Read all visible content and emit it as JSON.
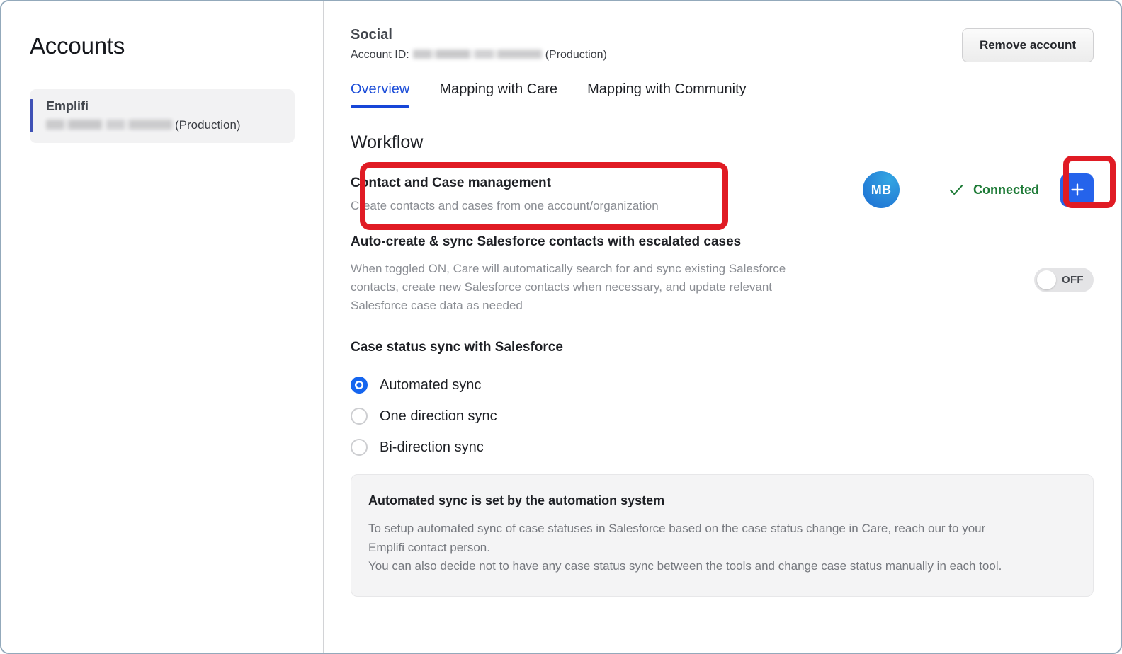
{
  "sidebar": {
    "title": "Accounts",
    "accounts": [
      {
        "name": "Emplifi",
        "id_masked": "",
        "environment": "(Production)"
      }
    ]
  },
  "header": {
    "title": "Social",
    "account_id_label": "Account ID:",
    "account_id_masked": "",
    "environment": "(Production)",
    "remove_account_label": "Remove account"
  },
  "tabs": [
    {
      "label": "Overview",
      "active": true
    },
    {
      "label": "Mapping with Care",
      "active": false
    },
    {
      "label": "Mapping with Community",
      "active": false
    }
  ],
  "workflow": {
    "section_title": "Workflow",
    "row": {
      "name": "Contact and Case management",
      "description": "Create contacts and cases from one account/organization",
      "avatar_initials": "MB",
      "status_label": "Connected",
      "status_color": "#1d7a36",
      "status_icon": "check-icon",
      "add_button_icon": "plus-icon",
      "add_button_color": "#2563eb"
    }
  },
  "auto_create": {
    "title": "Auto-create & sync Salesforce contacts with escalated cases",
    "description": "When toggled ON, Care will automatically search for and sync existing Salesforce contacts, create new Salesforce contacts when necessary, and update relevant Salesforce case data as needed",
    "toggle_state": "OFF"
  },
  "case_status_sync": {
    "title": "Case status sync with Salesforce",
    "options": [
      {
        "label": "Automated sync",
        "selected": true
      },
      {
        "label": "One direction sync",
        "selected": false
      },
      {
        "label": "Bi-direction sync",
        "selected": false
      }
    ]
  },
  "info_box": {
    "title": "Automated sync is set by the automation system",
    "line1": "To setup automated sync of case statuses in Salesforce based on the case status change in Care, reach our to your",
    "line2": "Emplifi contact person.",
    "line3": "You can also decide not to have any case status sync between the tools and change case status manually in each tool."
  },
  "annotations": {
    "color": "#e01b24",
    "targets": [
      "workflow-row",
      "add-button"
    ]
  }
}
